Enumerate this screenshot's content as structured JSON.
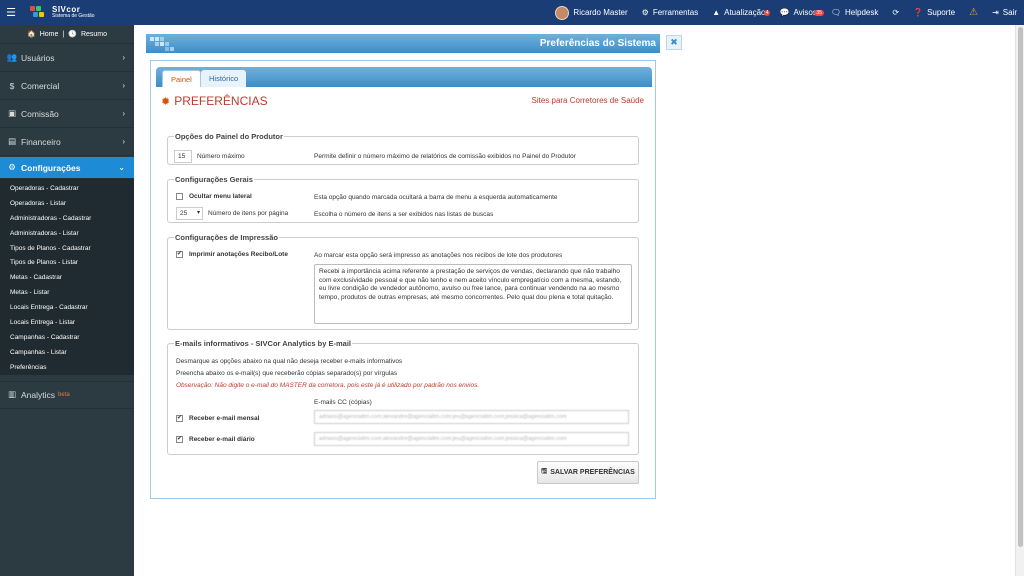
{
  "topbar": {
    "logo_name": "SIVcor",
    "logo_tagline": "Sistema de Gestão",
    "user": "Ricardo Master",
    "ferramentas": "Ferramentas",
    "atualizacao": "Atualização",
    "atualizacao_badge": "4",
    "avisos": "Avisos",
    "avisos_badge": "35",
    "helpdesk": "Helpdesk",
    "suporte": "Suporte",
    "sair": "Sair"
  },
  "sidebar": {
    "home": "Home",
    "resumo": "Resumo",
    "items": [
      {
        "label": "Usuários",
        "icon": "users-icon"
      },
      {
        "label": "Comercial",
        "icon": "dollar-icon"
      },
      {
        "label": "Comissão",
        "icon": "money-icon"
      },
      {
        "label": "Financeiro",
        "icon": "briefcase-icon"
      }
    ],
    "active": "Configurações",
    "sub_items": [
      "Operadoras - Cadastrar",
      "Operadoras - Listar",
      "Administradoras - Cadastrar",
      "Administradoras - Listar",
      "Tipos de Planos - Cadastrar",
      "Tipos de Planos - Listar",
      "Metas - Cadastrar",
      "Metas - Listar",
      "Locais Entrega - Cadastrar",
      "Locais Entrega - Listar",
      "Campanhas - Cadastrar",
      "Campanhas - Listar",
      "Preferências"
    ],
    "analytics": "Analytics",
    "beta": "beta"
  },
  "panel": {
    "title": "Preferências do Sistema",
    "tabs": [
      "Painel",
      "Histórico"
    ],
    "heading": "PREFERÊNCIAS",
    "right_link": "Sites para Corretores de Saúde"
  },
  "produtor": {
    "legend": "Opções do Painel do Produtor",
    "value": "15",
    "label": "Número máximo",
    "desc": "Permite definir o número máximo de relatórios de comissão exibidos no Painel do Produtor"
  },
  "gerais": {
    "legend": "Configurações Gerais",
    "ocultar_label": "Ocultar menu lateral",
    "ocultar_desc": "Esta opção quando marcada ocultará a barra de menu a esquerda automaticamente",
    "itens_value": "25",
    "itens_label": "Número de itens por página",
    "itens_desc": "Escolha o número de itens a ser exibidos nas listas de buscas"
  },
  "impressao": {
    "legend": "Configurações de Impressão",
    "imprimir_label": "Imprimir anotações Recibo/Lote",
    "imprimir_desc": "Ao marcar esta opção será impresso as anotações nos recibos de lote dos produtores",
    "texto": "Recebi a importância acima referente a prestação de serviços de vendas, declarando que não trabalho com exclusividade pessoal e que não tenho e nem aceito vínculo empregatício com a mesma, estando, eu livre condição de vendedor autônomo, avulso ou free lance, para continuar vendendo na ao mesmo tempo, produtos de outras empresas, até mesmo concorrentes. Pelo qual dou plena e total quitação."
  },
  "emails": {
    "legend": "E-mails informativos - SIVCor Analytics by E-mail",
    "line1": "Desmarque as opções abaixo na qual não deseja receber e-mails informativos",
    "line2": "Preencha abaixo os e-mail(s) que receberão cópias separado(s) por vírgulas",
    "note": "Observação: Não digite o e-mail do MASTER da corretora, pois este já é utilizado por padrão nos envios.",
    "cc_label": "E-mails CC (cópias)",
    "mensal_label": "Receber e-mail mensal",
    "mensal_value": "adriano@agencialtm.com;alexandre@agencialtm.com;jeu@agencialtm.com;jessica@agencialtm.com",
    "diario_label": "Receber e-mail diário",
    "diario_value": "adriano@agencialtm.com;alexandre@agencialtm.com;jeu@agencialtm.com;jessica@agencialtm.com"
  },
  "save_label": "SALVAR PREFERÊNCIAS"
}
